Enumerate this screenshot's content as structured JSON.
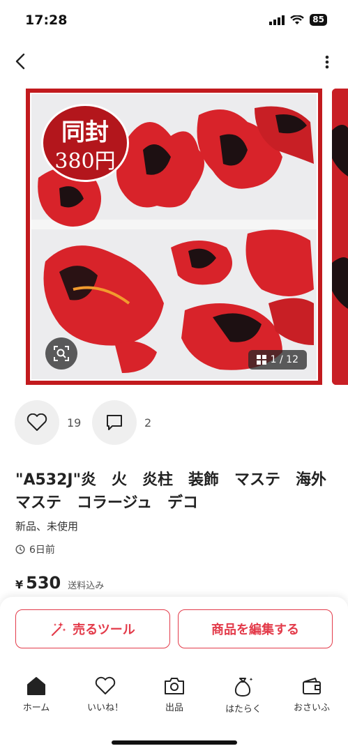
{
  "status_bar": {
    "time": "17:28",
    "battery": "85"
  },
  "image": {
    "badge_line1": "同封",
    "badge_line2": "380円",
    "counter": "1 / 12",
    "colors": {
      "frame": "#c21a1e",
      "flame": "#d8232a",
      "dark": "#1d1012"
    }
  },
  "actions": {
    "likes": "19",
    "comments": "2"
  },
  "product": {
    "title": "\"A532J\"炎　火　炎柱　装飾　マステ　海外マステ　コラージュ　デコ",
    "condition": "新品、未使用",
    "posted": "6日前",
    "price_currency": "¥",
    "price_value": "530",
    "shipping_note": "送料込み"
  },
  "buttons": {
    "sell_tool": "売るツール",
    "edit": "商品を編集する"
  },
  "tabbar": {
    "items": [
      {
        "label": "ホーム",
        "icon": "home-icon"
      },
      {
        "label": "いいね！",
        "icon": "heart-icon"
      },
      {
        "label": "出品",
        "icon": "camera-icon"
      },
      {
        "label": "はたらく",
        "icon": "money-bag-icon"
      },
      {
        "label": "おさいふ",
        "icon": "wallet-icon"
      }
    ]
  },
  "accent": "#e33b4a"
}
